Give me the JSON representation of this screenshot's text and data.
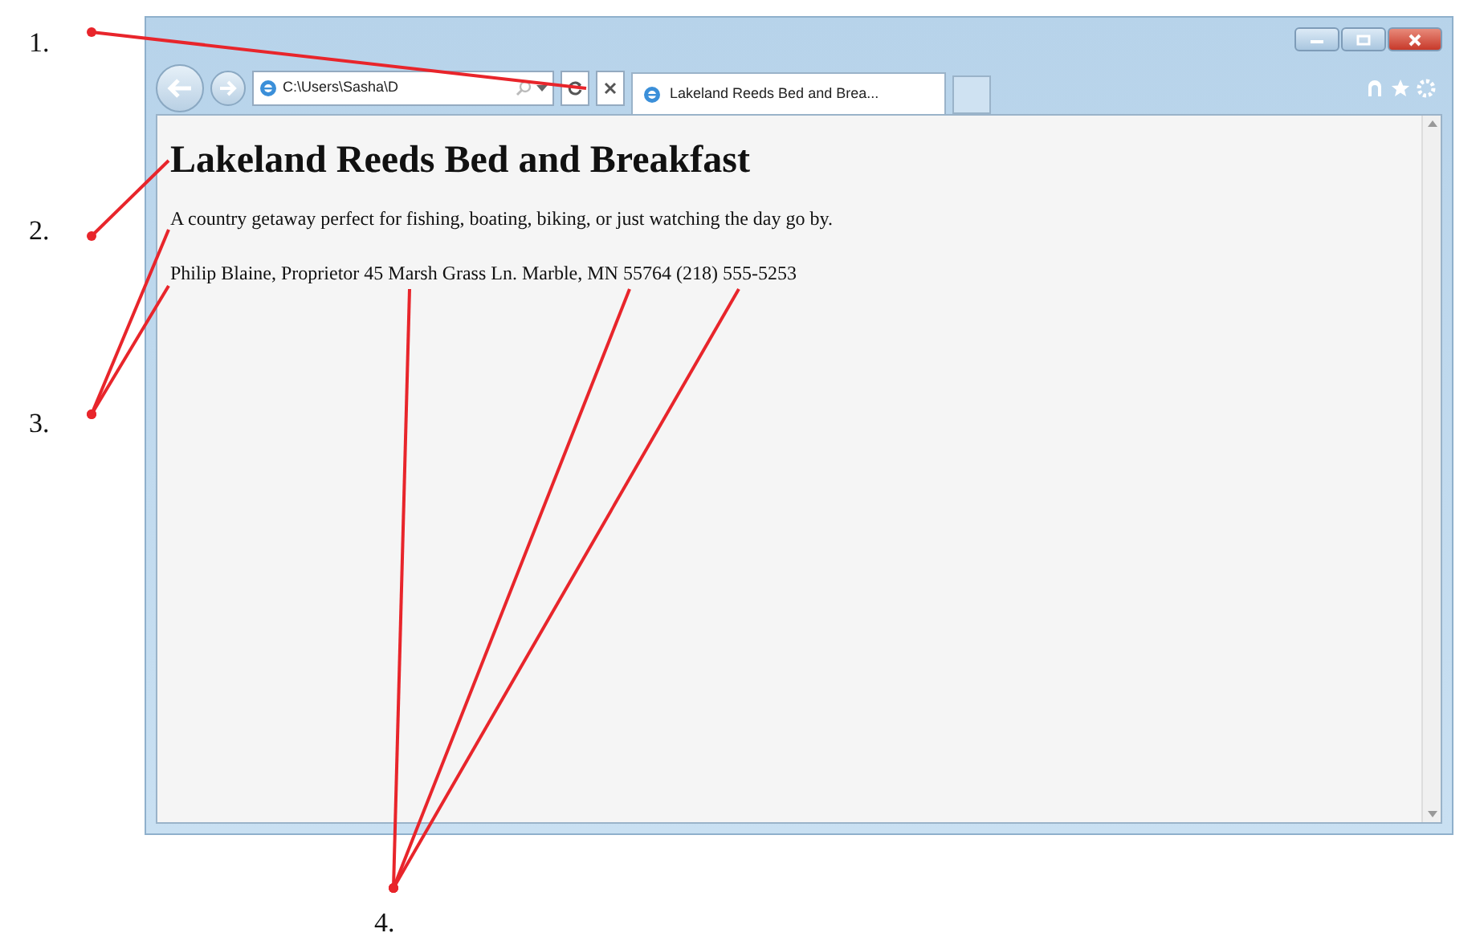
{
  "browser": {
    "address": "C:\\Users\\Sasha\\D",
    "tab_title": "Lakeland Reeds Bed and Brea..."
  },
  "page": {
    "heading": "Lakeland Reeds Bed and Breakfast",
    "tagline": "A country getaway perfect for fishing, boating, biking, or just watching the day go by.",
    "contact": "Philip Blaine, Proprietor 45 Marsh Grass Ln. Marble, MN 55764 (218) 555-5253"
  },
  "annotations": [
    {
      "label": "1."
    },
    {
      "label": "2."
    },
    {
      "label": "3."
    },
    {
      "label": "4."
    }
  ]
}
